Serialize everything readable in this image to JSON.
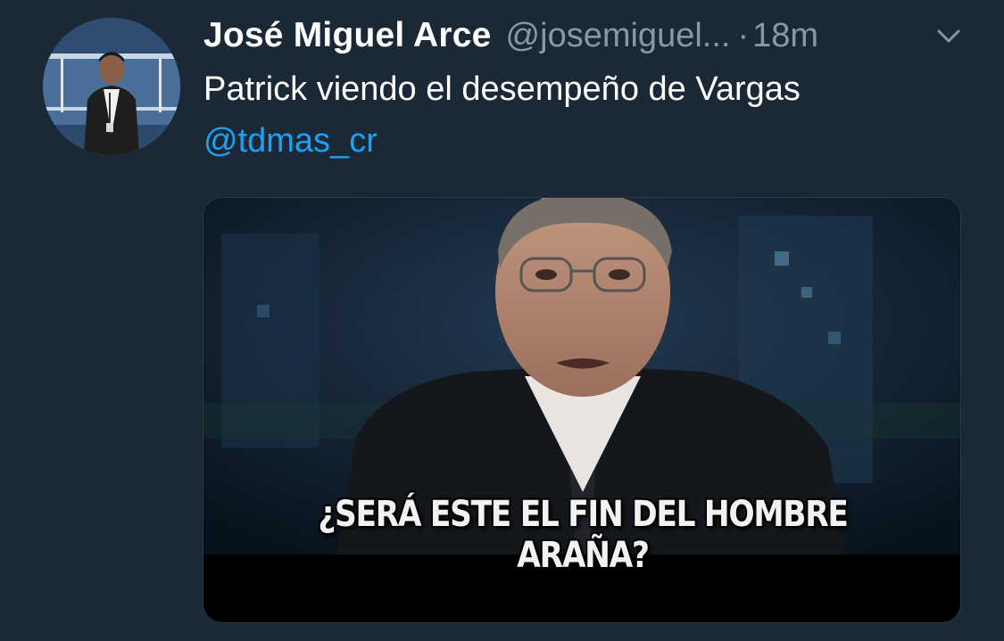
{
  "tweet": {
    "display_name": "José Miguel Arce",
    "handle": "@josemiguel...",
    "separator": "·",
    "timestamp": "18m",
    "text": "Patrick viendo el desempeño de Vargas",
    "mention": "@tdmas_cr",
    "media": {
      "caption": "¿SERÁ ESTE EL FIN DEL HOMBRE ARAÑA?"
    },
    "menu_icon": "chevron-down-icon",
    "avatar_icon": "avatar"
  },
  "colors": {
    "background": "#1b2836",
    "name": "#ffffff",
    "secondary_text": "#8899a6",
    "link": "#1da1f2"
  }
}
